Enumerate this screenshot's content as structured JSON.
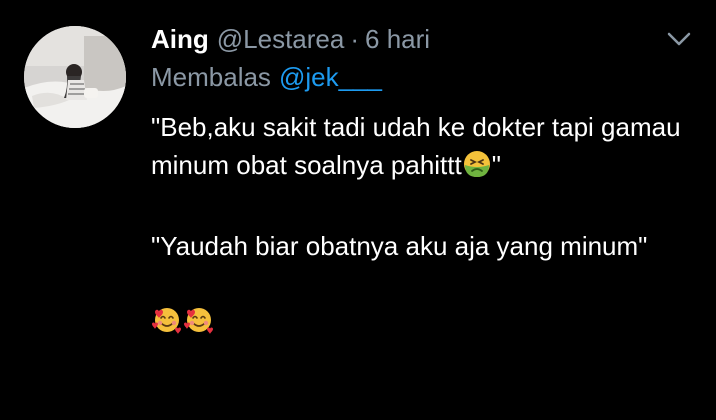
{
  "tweet": {
    "display_name": "Aing",
    "handle": "@Lestarea",
    "separator": "·",
    "time": "6 hari",
    "reply_label": "Membalas",
    "reply_to": "@jek___",
    "paragraph1_text": "\"Beb,aku sakit tadi udah ke dokter tapi gamau minum obat soalnya pahittt",
    "paragraph1_end": "\"",
    "paragraph2_text": "\"Yaudah biar obatnya aku aja yang minum\"",
    "emoji_nauseated": "nauseated-face-emoji",
    "emoji_smiling_hearts": "smiling-face-with-hearts-emoji"
  },
  "icons": {
    "avatar": "user-avatar-photo",
    "menu": "chevron-down-icon"
  },
  "colors": {
    "background": "#000000",
    "text_primary": "#ffffff",
    "text_secondary": "#8b98a5",
    "link": "#1d9bf0"
  }
}
